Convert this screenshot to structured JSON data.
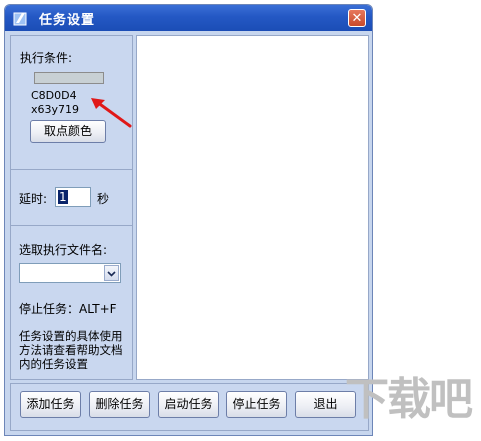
{
  "window": {
    "title": "任务设置",
    "close_glyph": "✕"
  },
  "condition": {
    "label": "执行条件:",
    "swatch_color": "#C8D0D4",
    "color_hex": "C8D0D4",
    "coords": "x63y719",
    "pick_button": "取点颜色"
  },
  "delay": {
    "label": "延时:",
    "value": "1",
    "unit": "秒"
  },
  "file": {
    "label": "选取执行文件名:",
    "selected": ""
  },
  "hotkey": {
    "label": "停止任务：ALT+F"
  },
  "help": {
    "text": "任务设置的具体使用方法请查看帮助文档内的任务设置"
  },
  "buttons": {
    "add": "添加任务",
    "delete": "删除任务",
    "start": "启动任务",
    "stop": "停止任务",
    "exit": "退出"
  },
  "watermark": {
    "logo_text": "下载吧"
  },
  "icons": {
    "title": "app-icon",
    "close": "close-icon",
    "combo": "chevron-down-icon",
    "annotation": "red-arrow-icon"
  }
}
